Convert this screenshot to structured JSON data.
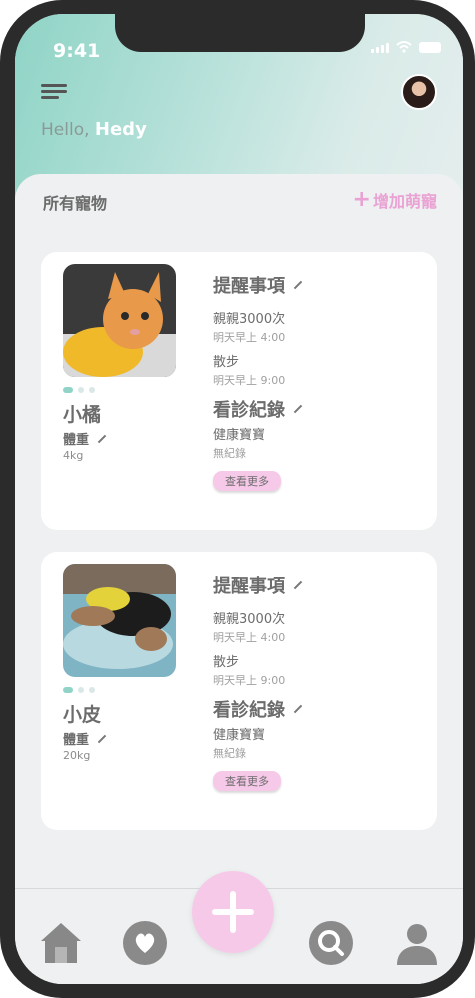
{
  "status_bar": {
    "time": "9:41"
  },
  "header": {
    "greeting": "Hello,",
    "user_name": "Hedy"
  },
  "section": {
    "title": "所有寵物",
    "add_label": "增加萌寵"
  },
  "pets": [
    {
      "name": "小橘",
      "weight_label": "體重",
      "weight_value": "4kg",
      "reminders_title": "提醒事項",
      "reminders": [
        {
          "title": "親親3000次",
          "time": "明天早上 4:00"
        },
        {
          "title": "散步",
          "time": "明天早上 9:00"
        }
      ],
      "records_title": "看診紀錄",
      "record_item": "健康寶寶",
      "record_sub": "無紀錄",
      "more_label": "查看更多"
    },
    {
      "name": "小皮",
      "weight_label": "體重",
      "weight_value": "20kg",
      "reminders_title": "提醒事項",
      "reminders": [
        {
          "title": "親親3000次",
          "time": "明天早上 4:00"
        },
        {
          "title": "散步",
          "time": "明天早上 9:00"
        }
      ],
      "records_title": "看診紀錄",
      "record_item": "健康寶寶",
      "record_sub": "無紀錄",
      "more_label": "查看更多"
    }
  ],
  "colors": {
    "accent_pink": "#f7c9e9",
    "accent_mint": "#8fd4c6"
  },
  "tabbar": {
    "icons": [
      "home-icon",
      "heart-icon",
      "add-icon",
      "search-icon",
      "profile-icon"
    ]
  }
}
